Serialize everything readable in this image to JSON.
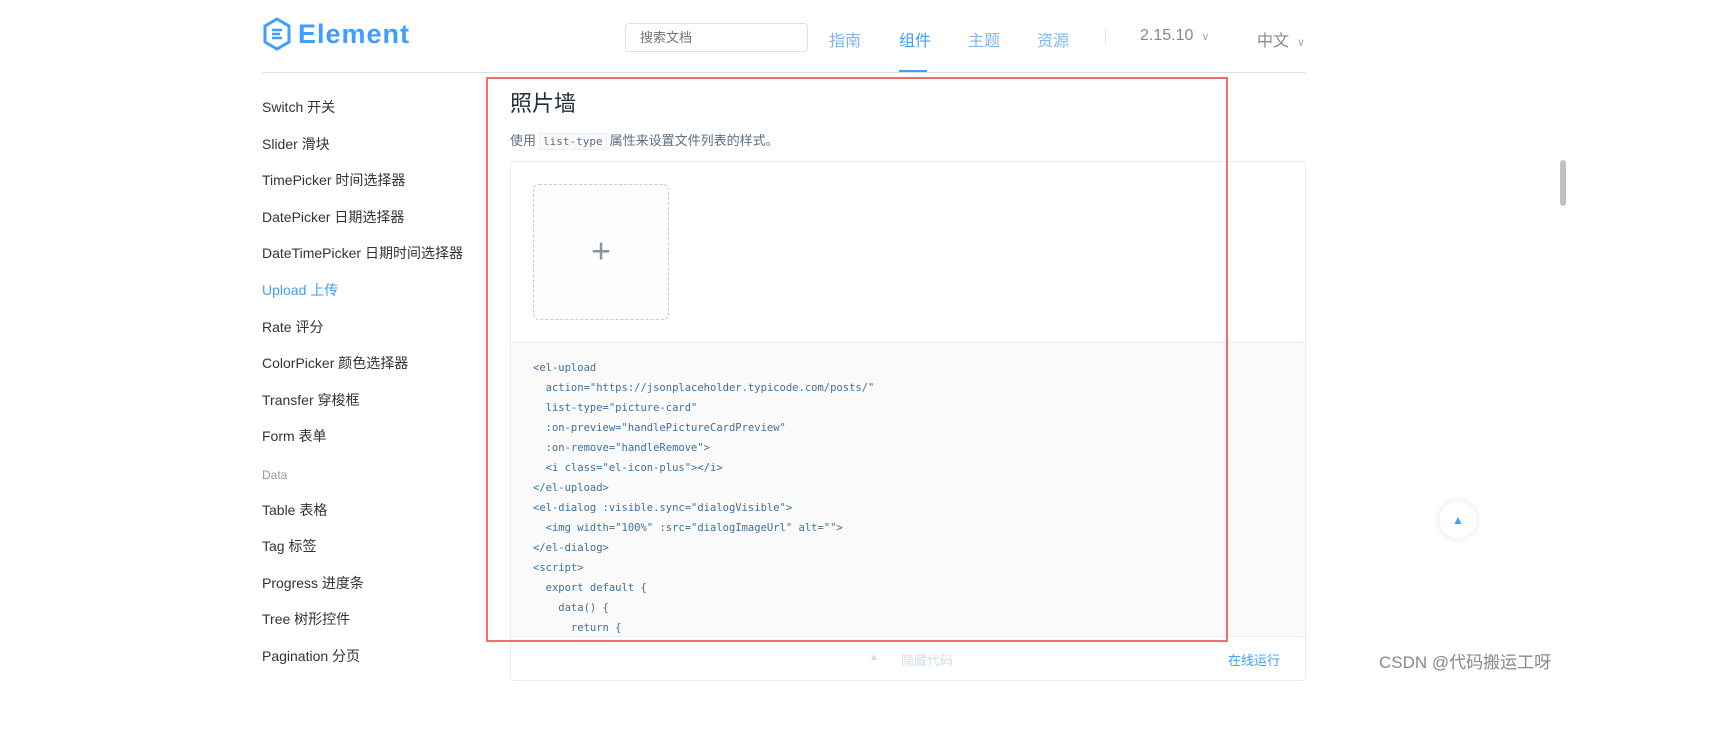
{
  "header": {
    "logo": "Element",
    "search_placeholder": "搜索文档",
    "nav": [
      "指南",
      "组件",
      "主题",
      "资源"
    ],
    "active_nav": 1,
    "version": "2.15.10",
    "language": "中文"
  },
  "sidebar": {
    "items": [
      {
        "label": "Switch 开关"
      },
      {
        "label": "Slider 滑块"
      },
      {
        "label": "TimePicker 时间选择器"
      },
      {
        "label": "DatePicker 日期选择器"
      },
      {
        "label": "DateTimePicker 日期时间选择器"
      },
      {
        "label": "Upload 上传",
        "active": true
      },
      {
        "label": "Rate 评分"
      },
      {
        "label": "ColorPicker 颜色选择器"
      },
      {
        "label": "Transfer 穿梭框"
      },
      {
        "label": "Form 表单"
      }
    ],
    "group": "Data",
    "group_items": [
      {
        "label": "Table 表格"
      },
      {
        "label": "Tag 标签"
      },
      {
        "label": "Progress 进度条"
      },
      {
        "label": "Tree 树形控件"
      },
      {
        "label": "Pagination 分页"
      }
    ]
  },
  "main": {
    "title": "照片墙",
    "desc_before": "使用",
    "desc_code": "list-type",
    "desc_after": "属性来设置文件列表的样式。",
    "code_lines": [
      "<el-upload",
      "  action=\"https://jsonplaceholder.typicode.com/posts/\"",
      "  list-type=\"picture-card\"",
      "  :on-preview=\"handlePictureCardPreview\"",
      "  :on-remove=\"handleRemove\">",
      "  <i class=\"el-icon-plus\"></i>",
      "</el-upload>",
      "<el-dialog :visible.sync=\"dialogVisible\">",
      "  <img width=\"100%\" :src=\"dialogImageUrl\" alt=\"\">",
      "</el-dialog>",
      "<script>",
      "  export default {",
      "    data() {",
      "      return {"
    ],
    "hide_code": "隐藏代码",
    "run_online": "在线运行"
  },
  "watermark": "CSDN @代码搬运工呀",
  "colors": {
    "accent": "#409eff",
    "highlight_box": "#f56c6c"
  }
}
